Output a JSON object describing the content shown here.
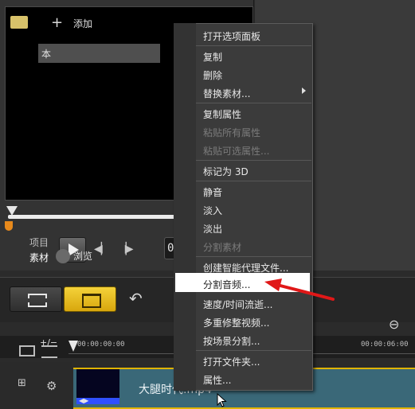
{
  "player": {
    "mode_project": "项目",
    "mode_clip": "素材",
    "timecode_partial": "0"
  },
  "library": {
    "add_label": "添加",
    "item_partial": "本",
    "browse_label": "浏览"
  },
  "timeline": {
    "track_manager": "+/−",
    "timecode_start": "00:00:00:00",
    "timecode_end": "00:00:06:00",
    "clip_name": "大腿时代.mp4"
  },
  "context_menu": {
    "items": [
      {
        "label": "打开选项面板",
        "enabled": true
      },
      {
        "label": "复制",
        "enabled": true
      },
      {
        "label": "删除",
        "enabled": true
      },
      {
        "label": "替换素材...",
        "enabled": true,
        "submenu": true
      },
      {
        "label": "复制属性",
        "enabled": true
      },
      {
        "label": "粘贴所有属性",
        "enabled": false
      },
      {
        "label": "粘贴可选属性...",
        "enabled": false
      },
      {
        "label": "标记为 3D",
        "enabled": true
      },
      {
        "label": "静音",
        "enabled": true
      },
      {
        "label": "淡入",
        "enabled": true
      },
      {
        "label": "淡出",
        "enabled": true
      },
      {
        "label": "分割素材",
        "enabled": false
      },
      {
        "label": "创建智能代理文件...",
        "enabled": true
      },
      {
        "label": "分割音频...",
        "enabled": true,
        "highlighted": true
      },
      {
        "label": "速度/时间流逝...",
        "enabled": true
      },
      {
        "label": "多重修整视频...",
        "enabled": true
      },
      {
        "label": "按场景分割...",
        "enabled": true
      },
      {
        "label": "打开文件夹...",
        "enabled": true
      },
      {
        "label": "属性...",
        "enabled": true
      }
    ]
  },
  "colors": {
    "accent_yellow": "#e0b400",
    "highlight_arrow": "#e01818",
    "clip_blue": "#3a6878"
  },
  "icons": {
    "play": "play-icon",
    "prev": "prev-frame-icon",
    "next": "next-frame-icon",
    "storyboard": "filmstrip-icon",
    "timeline": "timeline-icon",
    "undo": "undo-icon",
    "zoom": "zoom-icon"
  }
}
